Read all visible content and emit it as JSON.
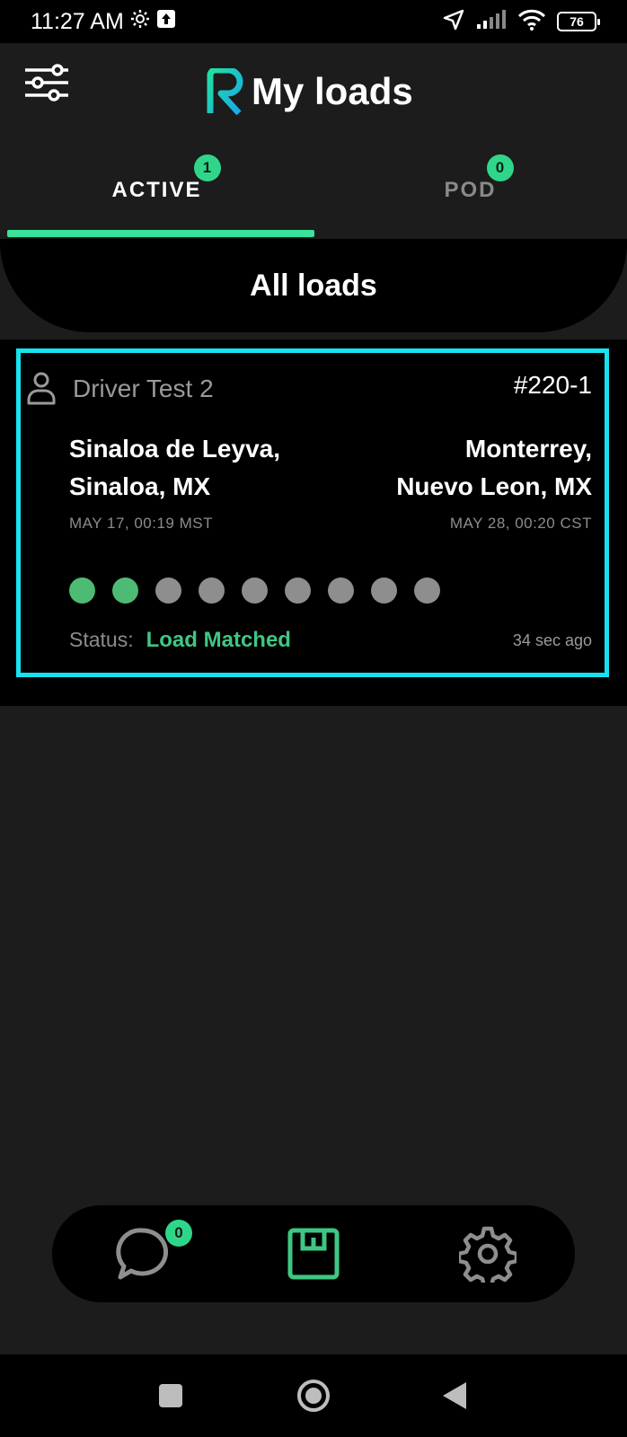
{
  "status_bar": {
    "time": "11:27 AM",
    "icons": [
      "gear-icon",
      "upload-icon",
      "location-arrow-icon",
      "signal-icon",
      "wifi-icon"
    ],
    "battery": "76"
  },
  "header": {
    "title": "My loads",
    "filter_icon": "sliders-icon",
    "logo_icon": "app-logo-r"
  },
  "tabs": [
    {
      "label": "ACTIVE",
      "badge": "1",
      "active": true
    },
    {
      "label": "POD",
      "badge": "0",
      "active": false
    }
  ],
  "list": {
    "heading": "All loads",
    "loads": [
      {
        "driver": "Driver Test 2",
        "load_id": "#220-1",
        "origin_line1": "Sinaloa de Leyva,",
        "origin_line2": "Sinaloa, MX",
        "origin_time": "MAY 17, 00:19 MST",
        "destination_line1": "Monterrey,",
        "destination_line2": "Nuevo Leon, MX",
        "destination_time": "MAY 28, 00:20 CST",
        "progress_steps_total": 9,
        "progress_steps_done": 2,
        "status_label": "Status:",
        "status_value": "Load Matched",
        "updated": "34 sec ago"
      }
    ]
  },
  "bottom_nav": {
    "items": [
      {
        "name": "chat",
        "icon": "chat-bubble-icon",
        "badge": "0"
      },
      {
        "name": "loads",
        "icon": "loads-box-icon",
        "active": true
      },
      {
        "name": "settings",
        "icon": "gear-icon"
      }
    ]
  },
  "colors": {
    "accent": "#3be39a",
    "badge": "#2fd68a",
    "card_border": "#16e3f0",
    "status": "#3ec783",
    "dot_done": "#4dbb74",
    "dot_pending": "#8e8e8e"
  }
}
